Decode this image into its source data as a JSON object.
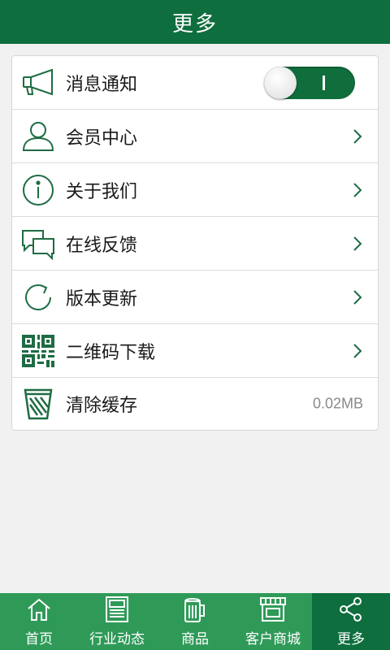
{
  "header": {
    "title": "更多"
  },
  "colors": {
    "brand": "#0e6e3e",
    "tabbar": "#2f9a58",
    "icon": "#1e6c43"
  },
  "settings": {
    "notifications": {
      "label": "消息通知",
      "icon": "megaphone-icon",
      "enabled": true
    },
    "member_center": {
      "label": "会员中心",
      "icon": "user-icon"
    },
    "about_us": {
      "label": "关于我们",
      "icon": "info-icon"
    },
    "feedback": {
      "label": "在线反馈",
      "icon": "chat-icon"
    },
    "version_update": {
      "label": "版本更新",
      "icon": "refresh-icon"
    },
    "qr_download": {
      "label": "二维码下载",
      "icon": "qr-code-icon"
    },
    "clear_cache": {
      "label": "清除缓存",
      "icon": "trash-icon",
      "value": "0.02MB"
    }
  },
  "tabs": [
    {
      "label": "首页",
      "icon": "home-icon",
      "active": false
    },
    {
      "label": "行业动态",
      "icon": "newspaper-icon",
      "active": false
    },
    {
      "label": "商品",
      "icon": "beer-mug-icon",
      "active": false
    },
    {
      "label": "客户商城",
      "icon": "storefront-icon",
      "active": false
    },
    {
      "label": "更多",
      "icon": "share-icon",
      "active": true
    }
  ]
}
